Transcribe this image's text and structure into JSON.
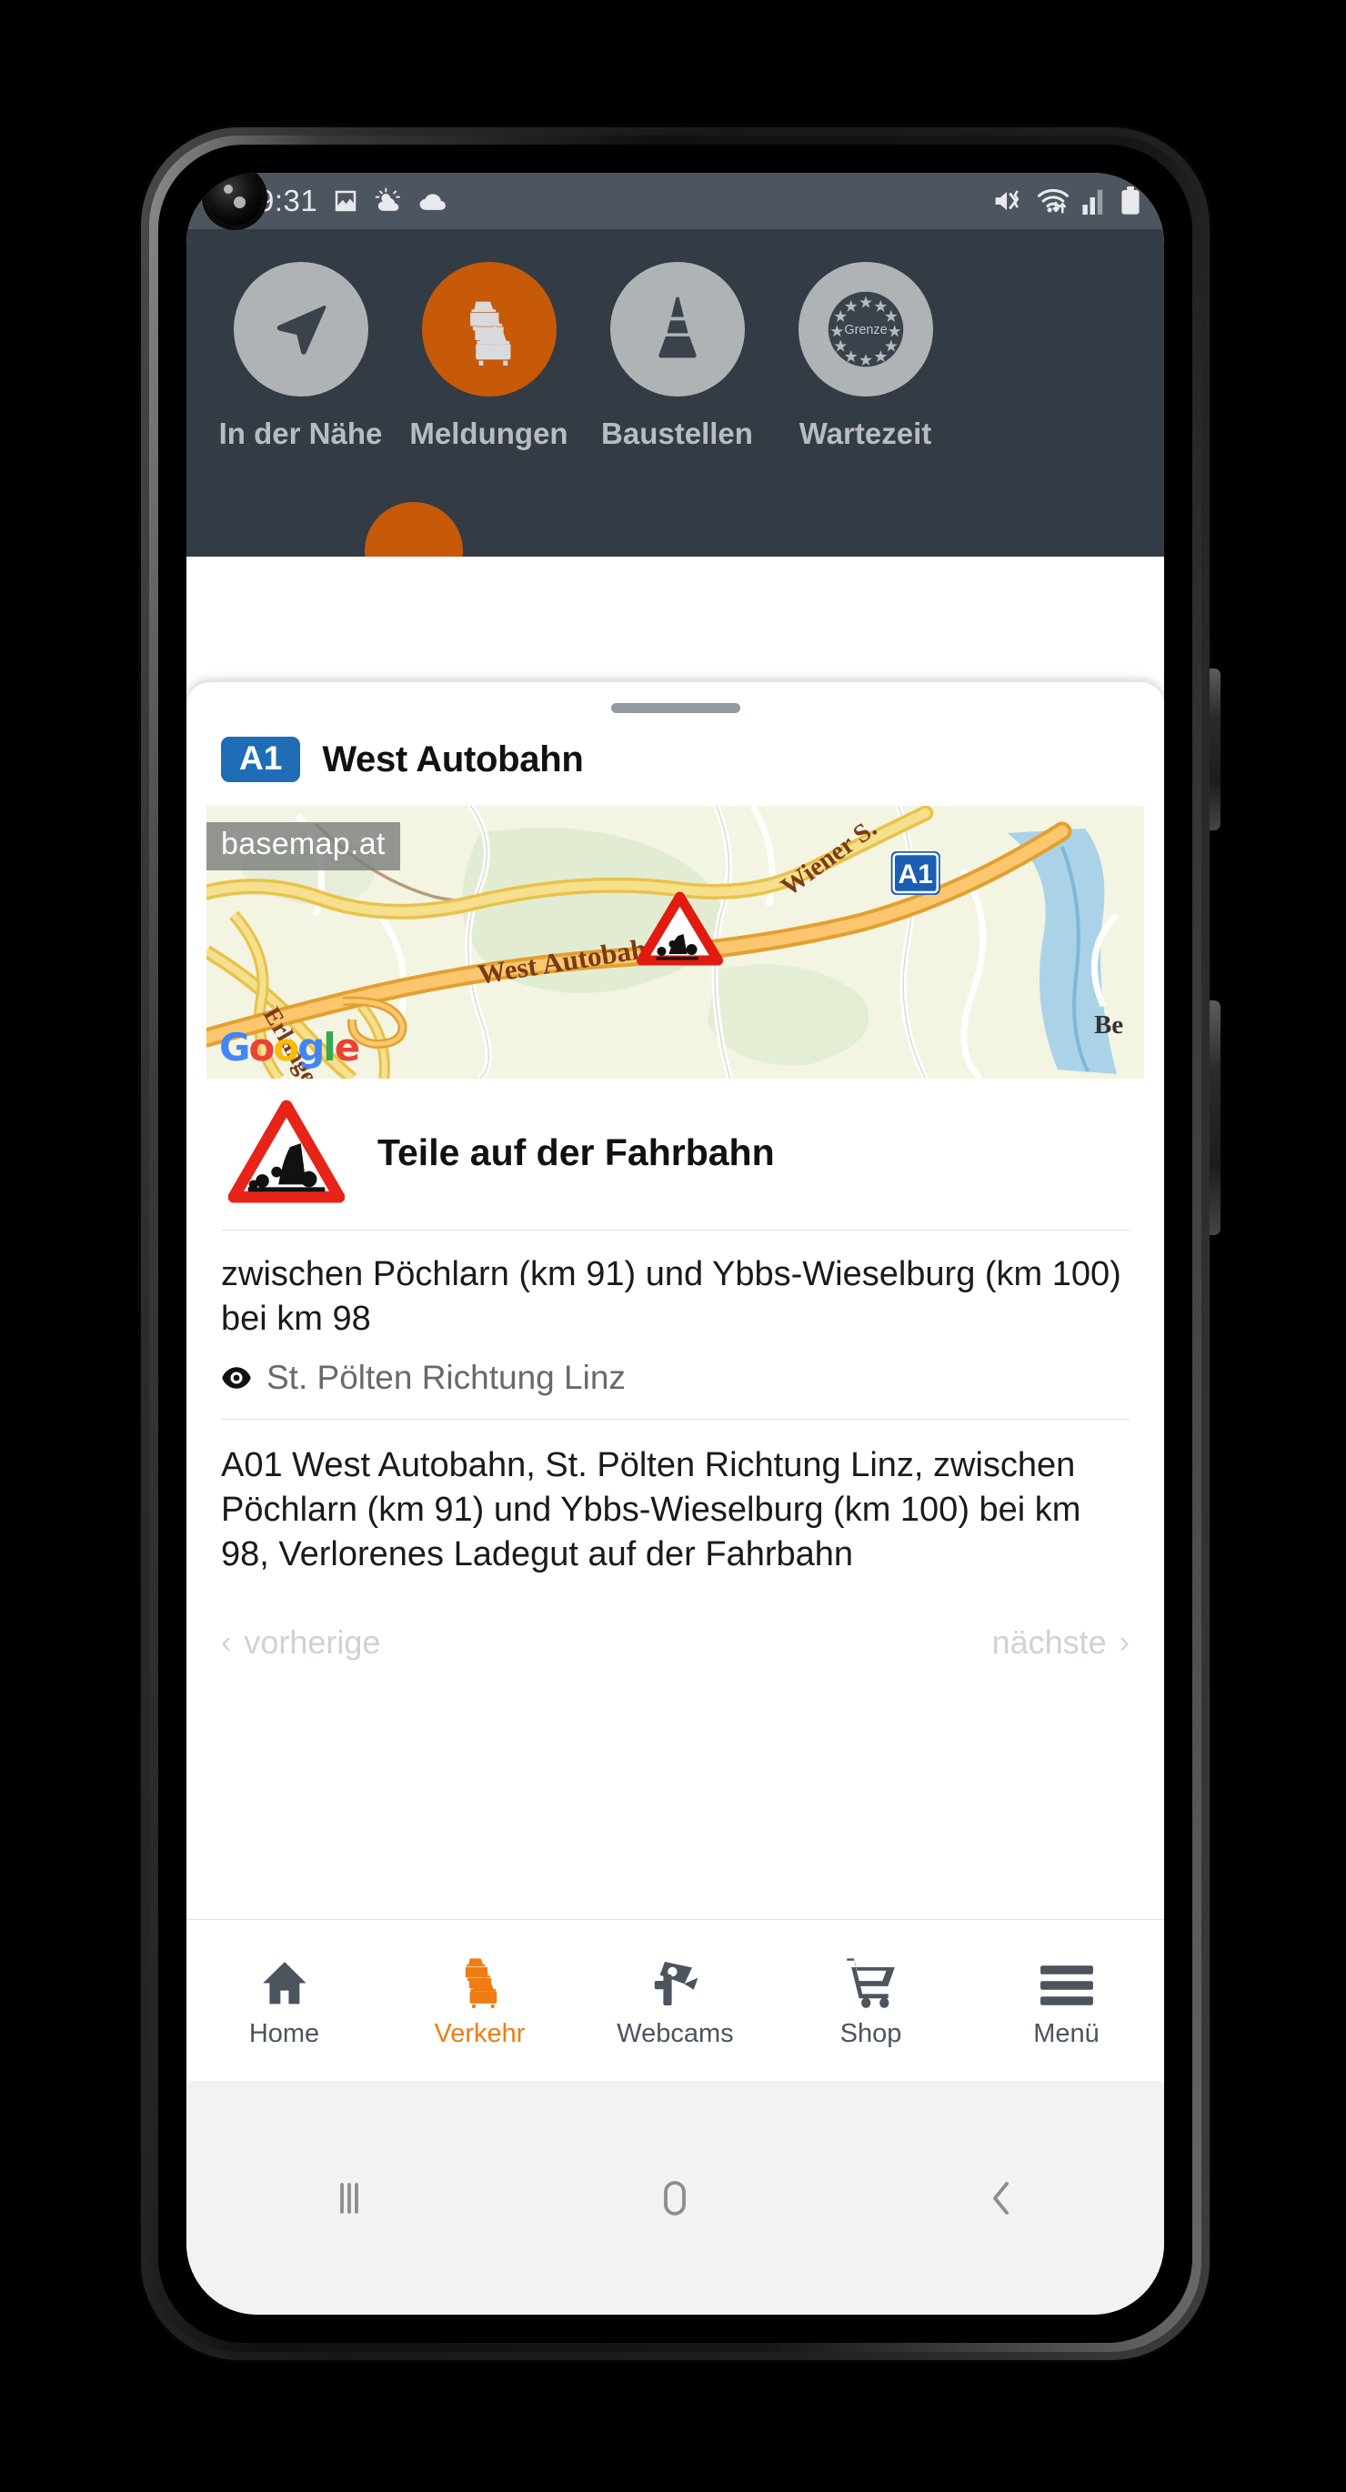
{
  "status_bar": {
    "time": "9:31",
    "left_icons": [
      "image-icon",
      "weather-partly-sunny-icon",
      "cloud-icon"
    ],
    "right_icons": [
      "mute-vibrate-icon",
      "wifi-icon",
      "signal-bars-icon",
      "battery-icon"
    ]
  },
  "app_header": {
    "categories": [
      {
        "label": "In der Nähe",
        "icon": "navigation-arrow-icon",
        "active": false
      },
      {
        "label": "Meldungen",
        "icon": "traffic-jam-icon",
        "active": true
      },
      {
        "label": "Baustellen",
        "icon": "traffic-cone-icon",
        "active": false
      },
      {
        "label": "Wartezeit",
        "icon": "border-grenze-icon",
        "active": false
      }
    ],
    "background_color": "#333b45",
    "accent_color": "#c65a09"
  },
  "detail_card": {
    "road_badge": "A1",
    "road_name": "West Autobahn",
    "map": {
      "watermark": "basemap.at",
      "attribution": "Google",
      "labels": [
        "Wiener S...",
        "West Autobahn",
        "Erlanger S...",
        "Be..."
      ],
      "shield": "A1",
      "marker": "debris-warning-triangle-icon"
    },
    "incident": {
      "icon": "debris-warning-triangle-icon",
      "title": "Teile auf der Fahrbahn",
      "location": "zwischen Pöchlarn (km 91) und Ybbs-Wieselburg (km 100) bei km 98",
      "direction_icon": "eye-icon",
      "direction": "St. Pölten Richtung Linz",
      "description": "A01 West Autobahn, St. Pölten Richtung Linz, zwischen Pöchlarn (km 91) und Ybbs-Wieselburg (km 100) bei km 98, Verlorenes Ladegut auf der Fahrbahn"
    },
    "pager": {
      "previous_label": "vorherige",
      "previous_chevron": "‹",
      "next_label": "nächste",
      "next_chevron": "›"
    }
  },
  "tab_bar": {
    "tabs": [
      {
        "label": "Home",
        "icon": "home-icon",
        "active": false
      },
      {
        "label": "Verkehr",
        "icon": "traffic-jam-icon",
        "active": true
      },
      {
        "label": "Webcams",
        "icon": "webcam-icon",
        "active": false
      },
      {
        "label": "Shop",
        "icon": "shopping-cart-icon",
        "active": false
      },
      {
        "label": "Menü",
        "icon": "hamburger-menu-icon",
        "active": false
      }
    ],
    "active_color": "#ee7d11",
    "inactive_color": "#4c545e"
  },
  "android_nav": {
    "buttons": [
      "recents-icon",
      "home-icon",
      "back-icon"
    ]
  }
}
